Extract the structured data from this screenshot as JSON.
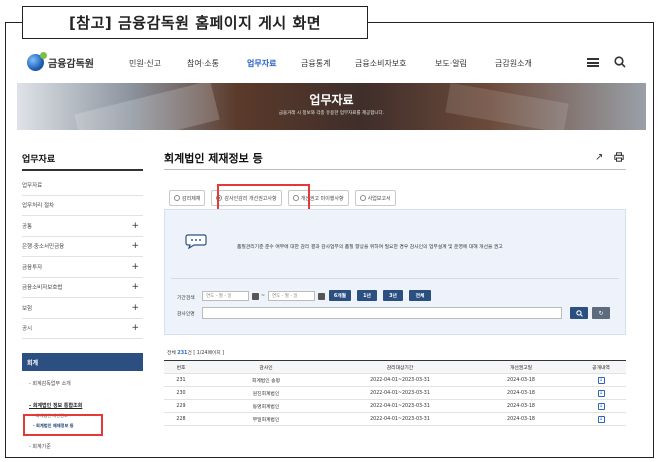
{
  "caption": "[참고] 금융감독원 홈페이지 게시 화면",
  "header": {
    "logo_text": "금융감독원",
    "nav": [
      "민원·신고",
      "참여·소통",
      "업무자료",
      "금융통계",
      "금융소비자보호",
      "보도·알림",
      "금감원소개"
    ],
    "active_nav": "업무자료"
  },
  "banner": {
    "title": "업무자료",
    "subtitle": "금융거래 시 정보와 각종 유용한 업무자료를 제공합니다."
  },
  "sidebar": {
    "title": "업무자료",
    "items": [
      {
        "label": "업무자료",
        "plus": ""
      },
      {
        "label": "업무처리 절차",
        "plus": ""
      },
      {
        "label": "공통",
        "plus": "+"
      },
      {
        "label": "은행·중소서민금융",
        "plus": "+"
      },
      {
        "label": "금융투자",
        "plus": "+"
      },
      {
        "label": "금융소비자보호법",
        "plus": "+"
      },
      {
        "label": "보험",
        "plus": "+"
      },
      {
        "label": "공시",
        "plus": "+"
      }
    ],
    "active_section": "회계",
    "sub_items": [
      "- 회계감독업무 소개",
      "- 회계법인 정보 통합조회",
      "· 회계법인 개선권고",
      "· 회계법인 제재정보 등",
      "- 회계기준"
    ]
  },
  "main": {
    "title": "회계법인 제재정보 등",
    "share_icon": "↗",
    "tabs": [
      {
        "label": "감리제재",
        "active": false
      },
      {
        "label": "감사인감리 개선권고사항",
        "active": true
      },
      {
        "label": "개선권고 미이행사항",
        "active": false
      },
      {
        "label": "사업보고서",
        "active": false
      }
    ],
    "notice": "품질관리기준 준수 여부에 대한 감리 결과 감사업무의 품질 향상을 위하여 필요한 경우 감사인의 업무설계 및 운영에 대해 개선을 권고",
    "search": {
      "period_label": "기간검색",
      "date_placeholder": "연도 - 월 - 일",
      "tilde": "~",
      "period_buttons": [
        "6개월",
        "1년",
        "3년",
        "전체"
      ],
      "auditor_label": "감사인명",
      "search_icon": "🔍",
      "reset_icon": "↻"
    },
    "count_prefix": "전체",
    "count_value": "231",
    "count_suffix": "건 [ 1/24페이지 ]",
    "table": {
      "headers": [
        "번호",
        "감사인",
        "감리대상기간",
        "개선권고일",
        "공개내역"
      ],
      "rows": [
        [
          "231",
          "회계법인 송평",
          "2022-04-01~2023-03-31",
          "2024-03-18"
        ],
        [
          "230",
          "원진회계법인",
          "2022-04-01~2023-03-31",
          "2024-03-18"
        ],
        [
          "229",
          "동명회계법인",
          "2022-04-01~2023-03-31",
          "2024-03-18"
        ],
        [
          "228",
          "부일회계법인",
          "2022-04-01~2023-03-31",
          "2024-03-18"
        ]
      ]
    }
  },
  "colors": {
    "accent": "#2a64c4",
    "nav_dark": "#2c4f82",
    "highlight": "#e53935"
  }
}
